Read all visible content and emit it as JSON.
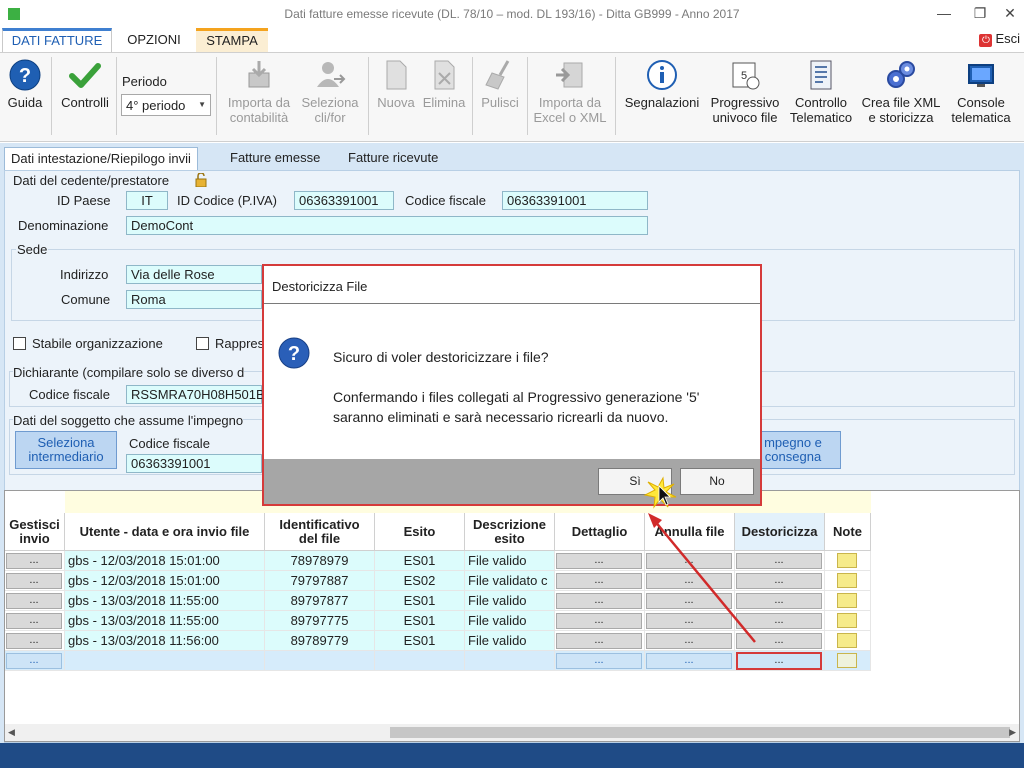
{
  "window": {
    "title": "Dati fatture emesse ricevute (DL. 78/10 – mod. DL 193/16) - Ditta GB999 - Anno 2017",
    "minimize_icon": "minimize-icon",
    "restore_icon": "restore-icon",
    "close_icon": "close-icon"
  },
  "ribbon_tabs": [
    "DATI FATTURE",
    "OPZIONI",
    "STAMPA"
  ],
  "esci_label": "Esci",
  "toolbar": {
    "guida": "Guida",
    "controlli": "Controlli",
    "periodo_label": "Periodo",
    "periodo_value": "4° periodo",
    "importa_contabilita": [
      "Importa da",
      "contabilità"
    ],
    "seleziona_clifor": [
      "Seleziona",
      "cli/for"
    ],
    "nuova": "Nuova",
    "elimina": "Elimina",
    "pulisci": "Pulisci",
    "importa_excel": [
      "Importa da",
      "Excel o XML"
    ],
    "segnalazioni": "Segnalazioni",
    "progressivo": [
      "Progressivo",
      "univoco file"
    ],
    "controllo": [
      "Controllo",
      "Telematico"
    ],
    "crea_file": [
      "Crea file XML",
      "e storicizza"
    ],
    "console": [
      "Console",
      "telematica"
    ]
  },
  "sub_tabs": [
    "Dati intestazione/Riepilogo invii",
    "Fatture emesse",
    "Fatture ricevute"
  ],
  "form": {
    "cedente_title": "Dati del cedente/prestatore",
    "id_paese_label": "ID Paese",
    "id_paese_value": "IT",
    "id_codice_label": "ID Codice (P.IVA)",
    "id_codice_value": "06363391001",
    "codice_fiscale_label": "Codice fiscale",
    "codice_fiscale_value": "06363391001",
    "denominazione_label": "Denominazione",
    "denominazione_value": "DemoCont",
    "sede_title": "Sede",
    "indirizzo_label": "Indirizzo",
    "indirizzo_value": "Via delle Rose",
    "comune_label": "Comune",
    "comune_value": "Roma",
    "stabile_label": "Stabile organizzazione",
    "rappres_label": "Rappres",
    "dichiarante_title": "Dichiarante (compilare solo se diverso d",
    "dich_cf_label": "Codice fiscale",
    "dich_cf_value": "RSSMRA70H08H501B",
    "soggetto_title": "Dati del soggetto che assume l'impegno",
    "seleziona_intermediario": [
      "Seleziona",
      "intermediario"
    ],
    "sogg_cf_label": "Codice fiscale",
    "sogg_cf_value": "06363391001",
    "impegno_btn": [
      "mpegno e",
      "consegna"
    ]
  },
  "grid": {
    "headers": [
      [
        "Gestisci",
        "invio"
      ],
      [
        "Utente - data e ora invio file"
      ],
      [
        "Identificativo",
        "del file"
      ],
      [
        "Esito"
      ],
      [
        "Descrizione",
        "esito"
      ],
      [
        "Dettaglio"
      ],
      [
        "Annulla file"
      ],
      [
        "Destoricizza"
      ],
      [
        "Note"
      ]
    ],
    "button_label": "...",
    "rows": [
      {
        "utente": "gbs - 12/03/2018 15:01:00",
        "id": "78978979",
        "esito": "ES01",
        "descr": "File valido"
      },
      {
        "utente": "gbs - 12/03/2018 15:01:00",
        "id": "79797887",
        "esito": "ES02",
        "descr": "File validato c"
      },
      {
        "utente": "gbs - 13/03/2018 11:55:00",
        "id": "89797877",
        "esito": "ES01",
        "descr": "File valido"
      },
      {
        "utente": "gbs - 13/03/2018 11:55:00",
        "id": "89797775",
        "esito": "ES01",
        "descr": "File valido"
      },
      {
        "utente": "gbs - 13/03/2018 11:56:00",
        "id": "89789779",
        "esito": "ES01",
        "descr": "File valido"
      }
    ]
  },
  "dialog": {
    "title": "Destoricizza File",
    "question": "Sicuro di voler destoricizzare i file?",
    "message_line1": "Confermando i files collegati al Progressivo generazione '5'",
    "message_line2": "saranno eliminati e sarà necessario ricrearli da nuovo.",
    "yes": "Sì",
    "no": "No",
    "icon": "question-icon"
  },
  "colors": {
    "accent_blue": "#1f5fb3",
    "field_bg": "#dcfcfc",
    "highlight_red": "#d53a3a",
    "bottom_bar": "#1f4b86"
  }
}
